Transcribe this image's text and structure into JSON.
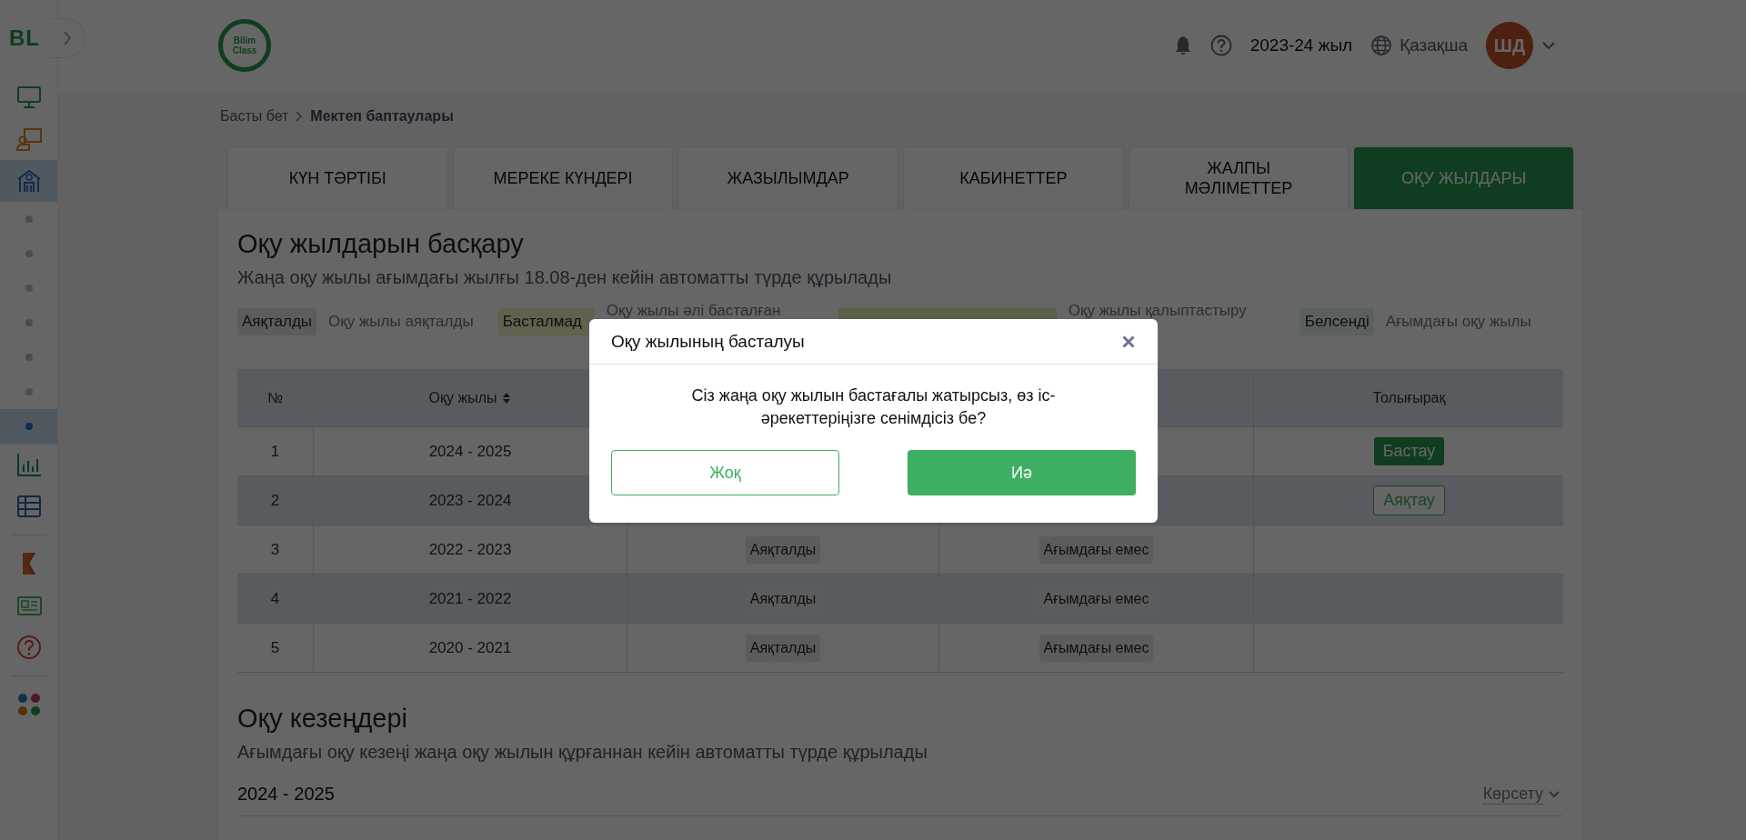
{
  "sidebar": {
    "logo": "BL",
    "items": [
      {
        "kind": "icon",
        "selected": false
      },
      {
        "kind": "icon",
        "selected": false
      },
      {
        "kind": "icon",
        "selected": true
      },
      {
        "kind": "dot",
        "selected": false
      },
      {
        "kind": "dot",
        "selected": false
      },
      {
        "kind": "dot",
        "selected": false
      },
      {
        "kind": "dot",
        "selected": false
      },
      {
        "kind": "dot",
        "selected": false
      },
      {
        "kind": "dot",
        "selected": false
      },
      {
        "kind": "dot",
        "selected": true
      },
      {
        "kind": "icon",
        "selected": false
      },
      {
        "kind": "icon",
        "selected": false
      },
      {
        "kind": "icon",
        "selected": false
      },
      {
        "kind": "icon",
        "selected": false
      },
      {
        "kind": "icon",
        "selected": false
      },
      {
        "kind": "icon",
        "selected": false
      }
    ]
  },
  "header": {
    "logo": "Bilim Class",
    "year": "2023-24 жыл",
    "language": "Қазақша",
    "avatar": "ШД"
  },
  "breadcrumb": [
    {
      "label": "Басты бет",
      "current": false
    },
    {
      "label": "Мектеп баптаулары",
      "current": true
    }
  ],
  "tabs": [
    {
      "label": "КҮН ТӘРТІБІ",
      "selected": false
    },
    {
      "label": "МЕРЕКЕ КҮНДЕРІ",
      "selected": false
    },
    {
      "label": "ЖАЗЫЛЫМДАР",
      "selected": false
    },
    {
      "label": "КАБИНЕТТЕР",
      "selected": false
    },
    {
      "label": "ЖАЛПЫ МӘЛІМЕТТЕР",
      "selected": false
    },
    {
      "label": "ОҚУ ЖЫЛДАРЫ",
      "selected": true
    }
  ],
  "years_section": {
    "title": "Оқу жылдарын басқару",
    "subtitle": "Жаңа оқу жылы ағымдағы жылғы 18.08-ден кейін автоматты түрде құрылады",
    "legend": [
      {
        "badge": "Аяқталды",
        "kind": "finished",
        "description": "Оқу жылы аяқталды",
        "wrapped": false
      },
      {
        "badge": "Басталмад",
        "kind": "pending",
        "description": "Оқу жылы әлі басталған",
        "wrapped": true
      },
      {
        "kind": "forming",
        "description": "Оқу жылы қалыптастыру",
        "wrapped": true
      },
      {
        "badge": "Белсенді",
        "kind": "active",
        "description": "Ағымдағы оқу жылы",
        "wrapped": false
      }
    ],
    "table": {
      "columns": {
        "number": "№",
        "year": "Оқу жылы",
        "action": "Толығырақ"
      },
      "rows": [
        {
          "number": "1",
          "year": "2024 - 2025",
          "action": {
            "label": "Бастау",
            "kind": "primary"
          }
        },
        {
          "number": "2",
          "year": "2023 - 2024",
          "action": {
            "label": "Аяқтау",
            "kind": "outline"
          }
        },
        {
          "number": "3",
          "year": "2022 - 2023",
          "column_3": "Аяқталды",
          "column_4": "Ағымдағы емес"
        },
        {
          "number": "4",
          "year": "2021 - 2022",
          "column_3": "Аяқталды",
          "column_4": "Ағымдағы емес"
        },
        {
          "number": "5",
          "year": "2020 - 2021",
          "column_3": "Аяқталды",
          "column_4": "Ағымдағы емес"
        }
      ]
    }
  },
  "periods_section": {
    "title": "Оқу кезеңдері",
    "subtitle": "Ағымдағы оқу кезеңі жаңа оқу жылын құрғаннан кейін автоматты түрде құрылады",
    "year": "2024 - 2025",
    "toggle": "Көрсету"
  },
  "modal": {
    "title": "Оқу жылының басталуы",
    "message": "Сіз жаңа оқу жылын бастағалы жатырсыз, өз іс-әрекеттеріңізге сенімдісіз бе?",
    "buttons": [
      {
        "label": "Жоқ",
        "kind": "secondary"
      },
      {
        "label": "Иә",
        "kind": "primary"
      }
    ]
  }
}
